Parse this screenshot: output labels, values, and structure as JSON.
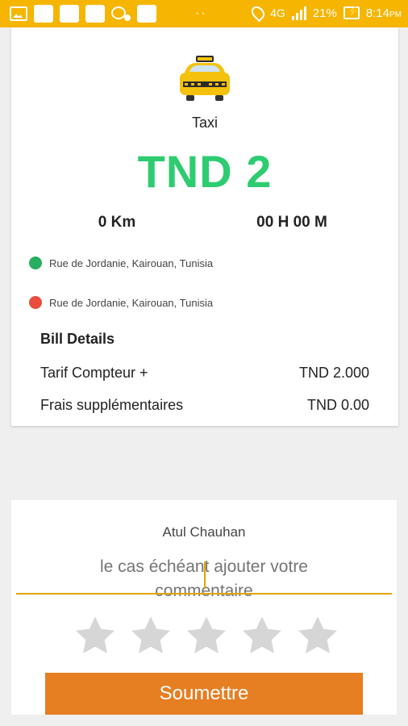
{
  "status_bar": {
    "network": "4G",
    "battery": "21%",
    "time": "8:14",
    "ampm": "PM",
    "color": "#f5b500"
  },
  "trip": {
    "vehicle_icon": "taxi-icon",
    "vehicle_name": "Taxi",
    "fare": "TND 2",
    "distance": "0 Km",
    "duration": "00 H 00 M",
    "pickup_address": "Rue de Jordanie, Kairouan, Tunisia",
    "dropoff_address": "Rue de Jordanie, Kairouan, Tunisia",
    "fare_color": "#2ecc71"
  },
  "bill": {
    "title": "Bill Details",
    "rows": [
      {
        "label": "Tarif Compteur +",
        "value": "TND 2.000"
      },
      {
        "label": "Frais supplémentaires",
        "value": "TND 0.00"
      }
    ]
  },
  "rating": {
    "driver_name": "Atul Chauhan",
    "comment_placeholder": "le cas échéant ajouter votre commentaire",
    "stars_total": 5,
    "stars_selected": 0,
    "submit_label": "Soumettre",
    "submit_color": "#e67e22"
  }
}
